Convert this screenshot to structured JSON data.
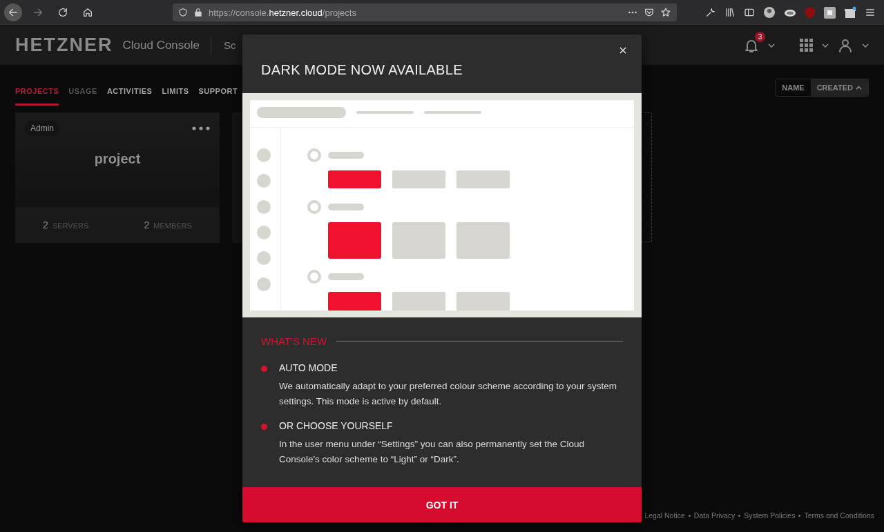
{
  "browser": {
    "url_prefix": "https://console.",
    "url_domain": "hetzner.cloud",
    "url_path": "/projects"
  },
  "header": {
    "logo": "HETZNER",
    "product": "Cloud Console",
    "nav_partial": "Sc",
    "notification_count": "3"
  },
  "tabs": [
    {
      "label": "PROJECTS",
      "selected": true,
      "disabled": false
    },
    {
      "label": "USAGE",
      "selected": false,
      "disabled": true
    },
    {
      "label": "ACTIVITIES",
      "selected": false,
      "disabled": false
    },
    {
      "label": "LIMITS",
      "selected": false,
      "disabled": false
    },
    {
      "label": "SUPPORT",
      "selected": false,
      "disabled": false
    }
  ],
  "sort": [
    {
      "label": "NAME",
      "selected": false
    },
    {
      "label": "CREATED",
      "selected": true
    }
  ],
  "project_card": {
    "role": "Admin",
    "name": "project",
    "stats": [
      {
        "value": "2",
        "label": "SERVERS"
      },
      {
        "value": "2",
        "label": "MEMBERS"
      }
    ]
  },
  "modal": {
    "title": "DARK MODE NOW AVAILABLE",
    "section_title": "WHAT'S NEW",
    "items": [
      {
        "title": "AUTO MODE",
        "text": "We automatically adapt to your preferred colour scheme according to your system settings. This mode is active by default."
      },
      {
        "title": "OR CHOOSE YOURSELF",
        "text": "In the user menu under “Settings” you can also permanently set the Cloud Console's color scheme to “Light” or “Dark”."
      }
    ],
    "button": "GOT IT"
  },
  "footer_links": [
    "Legal Notice",
    "Data Privacy",
    "System Policies",
    "Terms and Conditions"
  ]
}
